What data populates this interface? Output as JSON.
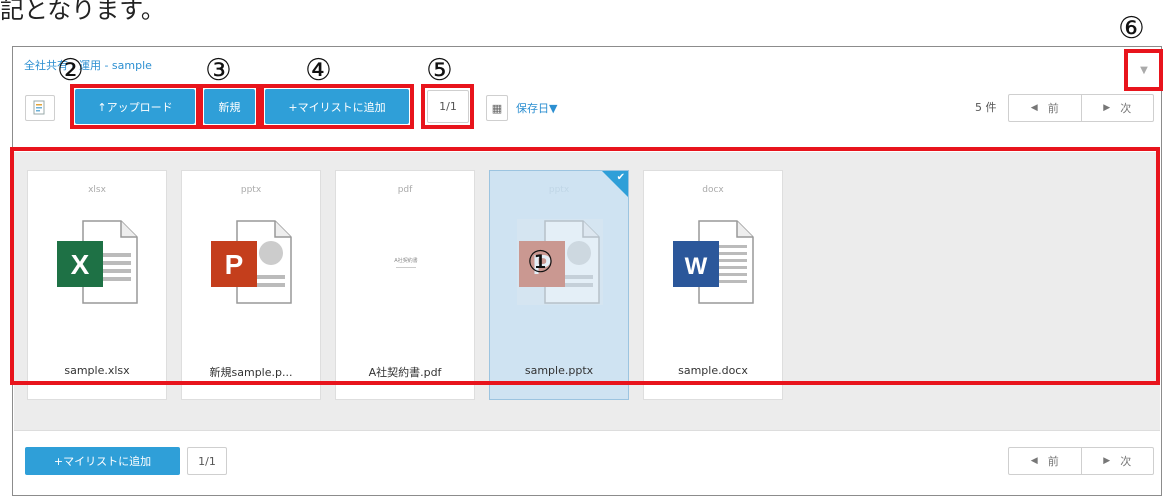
{
  "intro_text": "記となります。",
  "breadcrumb": "全社共有 - 運用 - sample",
  "toolbar": {
    "upload_label": "↑アップロード",
    "new_label": "新規",
    "add_mylist_label": "+マイリストに追加",
    "page_indicator": "1/1",
    "sort_label": "保存日▼",
    "count_label": "5 件",
    "prev_label": "前",
    "next_label": "次"
  },
  "files": [
    {
      "ext": "xlsx",
      "name": "sample.xlsx",
      "icon": "excel-icon",
      "letter": "X",
      "color": "#1e7145"
    },
    {
      "ext": "pptx",
      "name": "新規sample.p...",
      "icon": "powerpoint-icon",
      "letter": "P",
      "color": "#c43e1c"
    },
    {
      "ext": "pdf",
      "name": "A社契約書.pdf",
      "icon": "pdf-preview",
      "letter": "",
      "color": "#999999",
      "preview_text": "A社契約書"
    },
    {
      "ext": "pptx",
      "name": "sample.pptx",
      "icon": "powerpoint-icon",
      "letter": "P",
      "color": "#c43e1c",
      "selected": true
    },
    {
      "ext": "docx",
      "name": "sample.docx",
      "icon": "word-icon",
      "letter": "W",
      "color": "#2b579a"
    }
  ],
  "footer": {
    "add_mylist_label": "+マイリストに追加",
    "page_indicator": "1/1",
    "prev_label": "前",
    "next_label": "次"
  },
  "markers": {
    "m1": "①",
    "m2": "②",
    "m3": "③",
    "m4": "④",
    "m5": "⑤",
    "m6": "⑥"
  },
  "colors": {
    "accent": "#2f9fd8",
    "highlight": "#e8141c",
    "selected": "#cfe3f2"
  }
}
